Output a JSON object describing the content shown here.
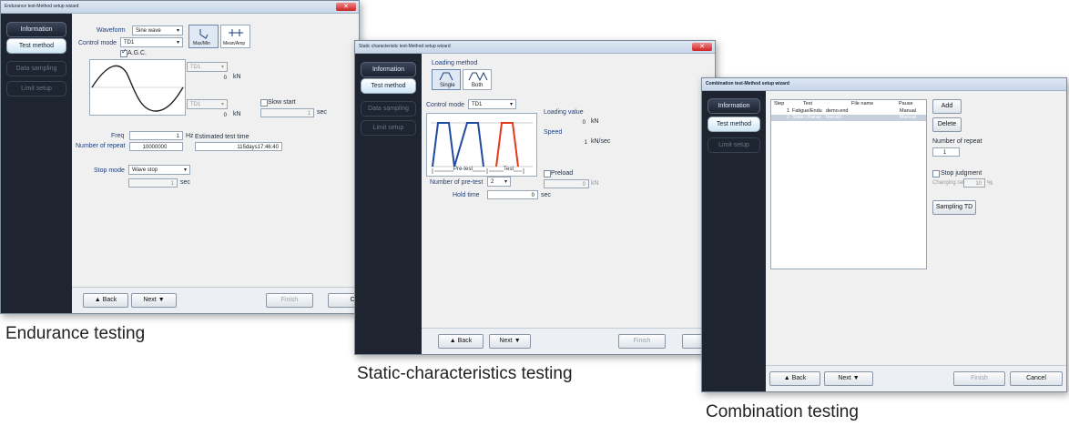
{
  "win1": {
    "title": "Endurance test-Method setup wizard",
    "nav": [
      "Information",
      "Test method",
      "Data sampling",
      "Limit setup"
    ],
    "waveform_label": "Waveform",
    "waveform_value": "Sine wave",
    "control_mode_label": "Control mode",
    "control_mode_value": "TD1",
    "agc_label": "A.G.C.",
    "maxmin_label": "Max/Min",
    "meanamp_label": "Mean/Amp",
    "ch_top": "TD1",
    "ch_bottom": "TD1",
    "top_value": "0",
    "bottom_value": "0",
    "unit_kn": "kN",
    "slow_start_label": "Slow start",
    "slow_start_value": "1",
    "sec": "sec",
    "freq_label": "Freq",
    "freq_value": "1",
    "hz": "Hz",
    "est_label": "Estimated test time",
    "repeat_label": "Number of repeat",
    "repeat_value": "10000000",
    "est_value": "115days17:46:40",
    "stop_mode_label": "Stop mode",
    "stop_mode_value": "Wave stop",
    "stop_sec_value": "1",
    "back": "▲ Back",
    "next": "Next ▼",
    "finish": "Finish",
    "cancel": "Canc"
  },
  "win2": {
    "title": "Static characteristic test-Method setup wizard",
    "nav": [
      "Information",
      "Test method",
      "Data sampling",
      "Limit setup"
    ],
    "loading_method_label": "Loading method",
    "single_label": "Single",
    "both_label": "Both",
    "control_mode_label": "Control mode",
    "control_mode_value": "TD1",
    "loading_value_label": "Loading value",
    "loading_value": "0",
    "unit_kn": "kN",
    "speed_label": "Speed",
    "speed_value": "1",
    "speed_unit": "kN/sec",
    "pretest_label": "Pre-test",
    "test_label": "Test",
    "num_pretest_label": "Number of pre-test",
    "num_pretest_value": "2",
    "preload_label": "Preload",
    "preload_value": "0",
    "hold_time_label": "Hold time",
    "hold_time_value": "0",
    "sec": "sec",
    "back": "▲ Back",
    "next": "Next ▼",
    "finish": "Finish",
    "cancel": "Can"
  },
  "win3": {
    "title": "Combination test-Method setup wizard",
    "nav": [
      "Information",
      "Test method",
      "Limit setup"
    ],
    "table_headers": [
      "Step",
      "Test",
      "File name",
      "Pause"
    ],
    "rows": [
      [
        "1",
        "Fatigue/Endu",
        "demo.end",
        "Manual"
      ],
      [
        "2",
        "Static charac",
        "test.stc",
        "Manual"
      ]
    ],
    "add": "Add",
    "delete": "Delete",
    "repeat_label": "Number of repeat",
    "repeat_value": "1",
    "stop_judgment_label": "Stop judgment",
    "changing_rate_label": "Changing rate",
    "changing_rate_value": "10",
    "percent": "%",
    "sampling_td": "Sampling TD",
    "back": "▲ Back",
    "next": "Next ▼",
    "finish": "Finish",
    "cancel": "Cancel"
  },
  "captions": {
    "endurance": "Endurance testing",
    "static": "Static-characteristics testing",
    "combination": "Combination testing"
  },
  "colors": {
    "sidebar": "#1e2430",
    "wave_blue": "#1f4aa0",
    "wave_red": "#e03a1a"
  }
}
